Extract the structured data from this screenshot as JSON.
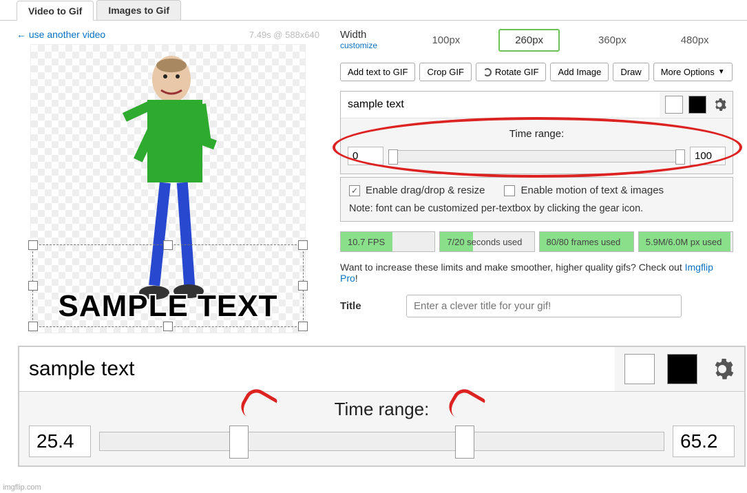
{
  "tabs": {
    "video": "Video to Gif",
    "images": "Images to Gif"
  },
  "left": {
    "use_another": "← use another video",
    "video_meta": "7.49s @ 588x640",
    "overlay_text": "SAMPLE TEXT"
  },
  "width": {
    "label": "Width",
    "customize": "customize",
    "options": [
      "100px",
      "260px",
      "360px",
      "480px"
    ],
    "selected": "260px"
  },
  "actions": {
    "add_text": "Add text to GIF",
    "crop": "Crop GIF",
    "rotate": "Rotate GIF",
    "add_image": "Add Image",
    "draw": "Draw",
    "more": "More Options"
  },
  "textbox": {
    "value": "sample text",
    "color1": "#ffffff",
    "color2": "#000000"
  },
  "time_range": {
    "label": "Time range:",
    "start": "0",
    "end": "100"
  },
  "options": {
    "drag_resize": {
      "label": "Enable drag/drop & resize",
      "checked": true
    },
    "motion": {
      "label": "Enable motion of text & images",
      "checked": false
    },
    "note": "Note: font can be customized per-textbox by clicking the gear icon."
  },
  "stats": {
    "fps": {
      "label": "10.7 FPS",
      "pct": 55
    },
    "seconds": {
      "label": "7/20 seconds used",
      "pct": 35
    },
    "frames": {
      "label": "80/80 frames used",
      "pct": 100
    },
    "px": {
      "label": "5.9M/6.0M px used",
      "pct": 98
    }
  },
  "limits": {
    "prefix": "Want to increase these limits and make smoother, higher quality gifs? Check out ",
    "link": "Imgflip Pro",
    "suffix": "!"
  },
  "title": {
    "label": "Title",
    "placeholder": "Enter a clever title for your gif!"
  },
  "zoom": {
    "value": "sample text",
    "label": "Time range:",
    "start": "25.4",
    "end": "65.2",
    "thumb1_pct": 25.4,
    "thumb2_pct": 65.2
  },
  "watermark": "imgflip.com"
}
